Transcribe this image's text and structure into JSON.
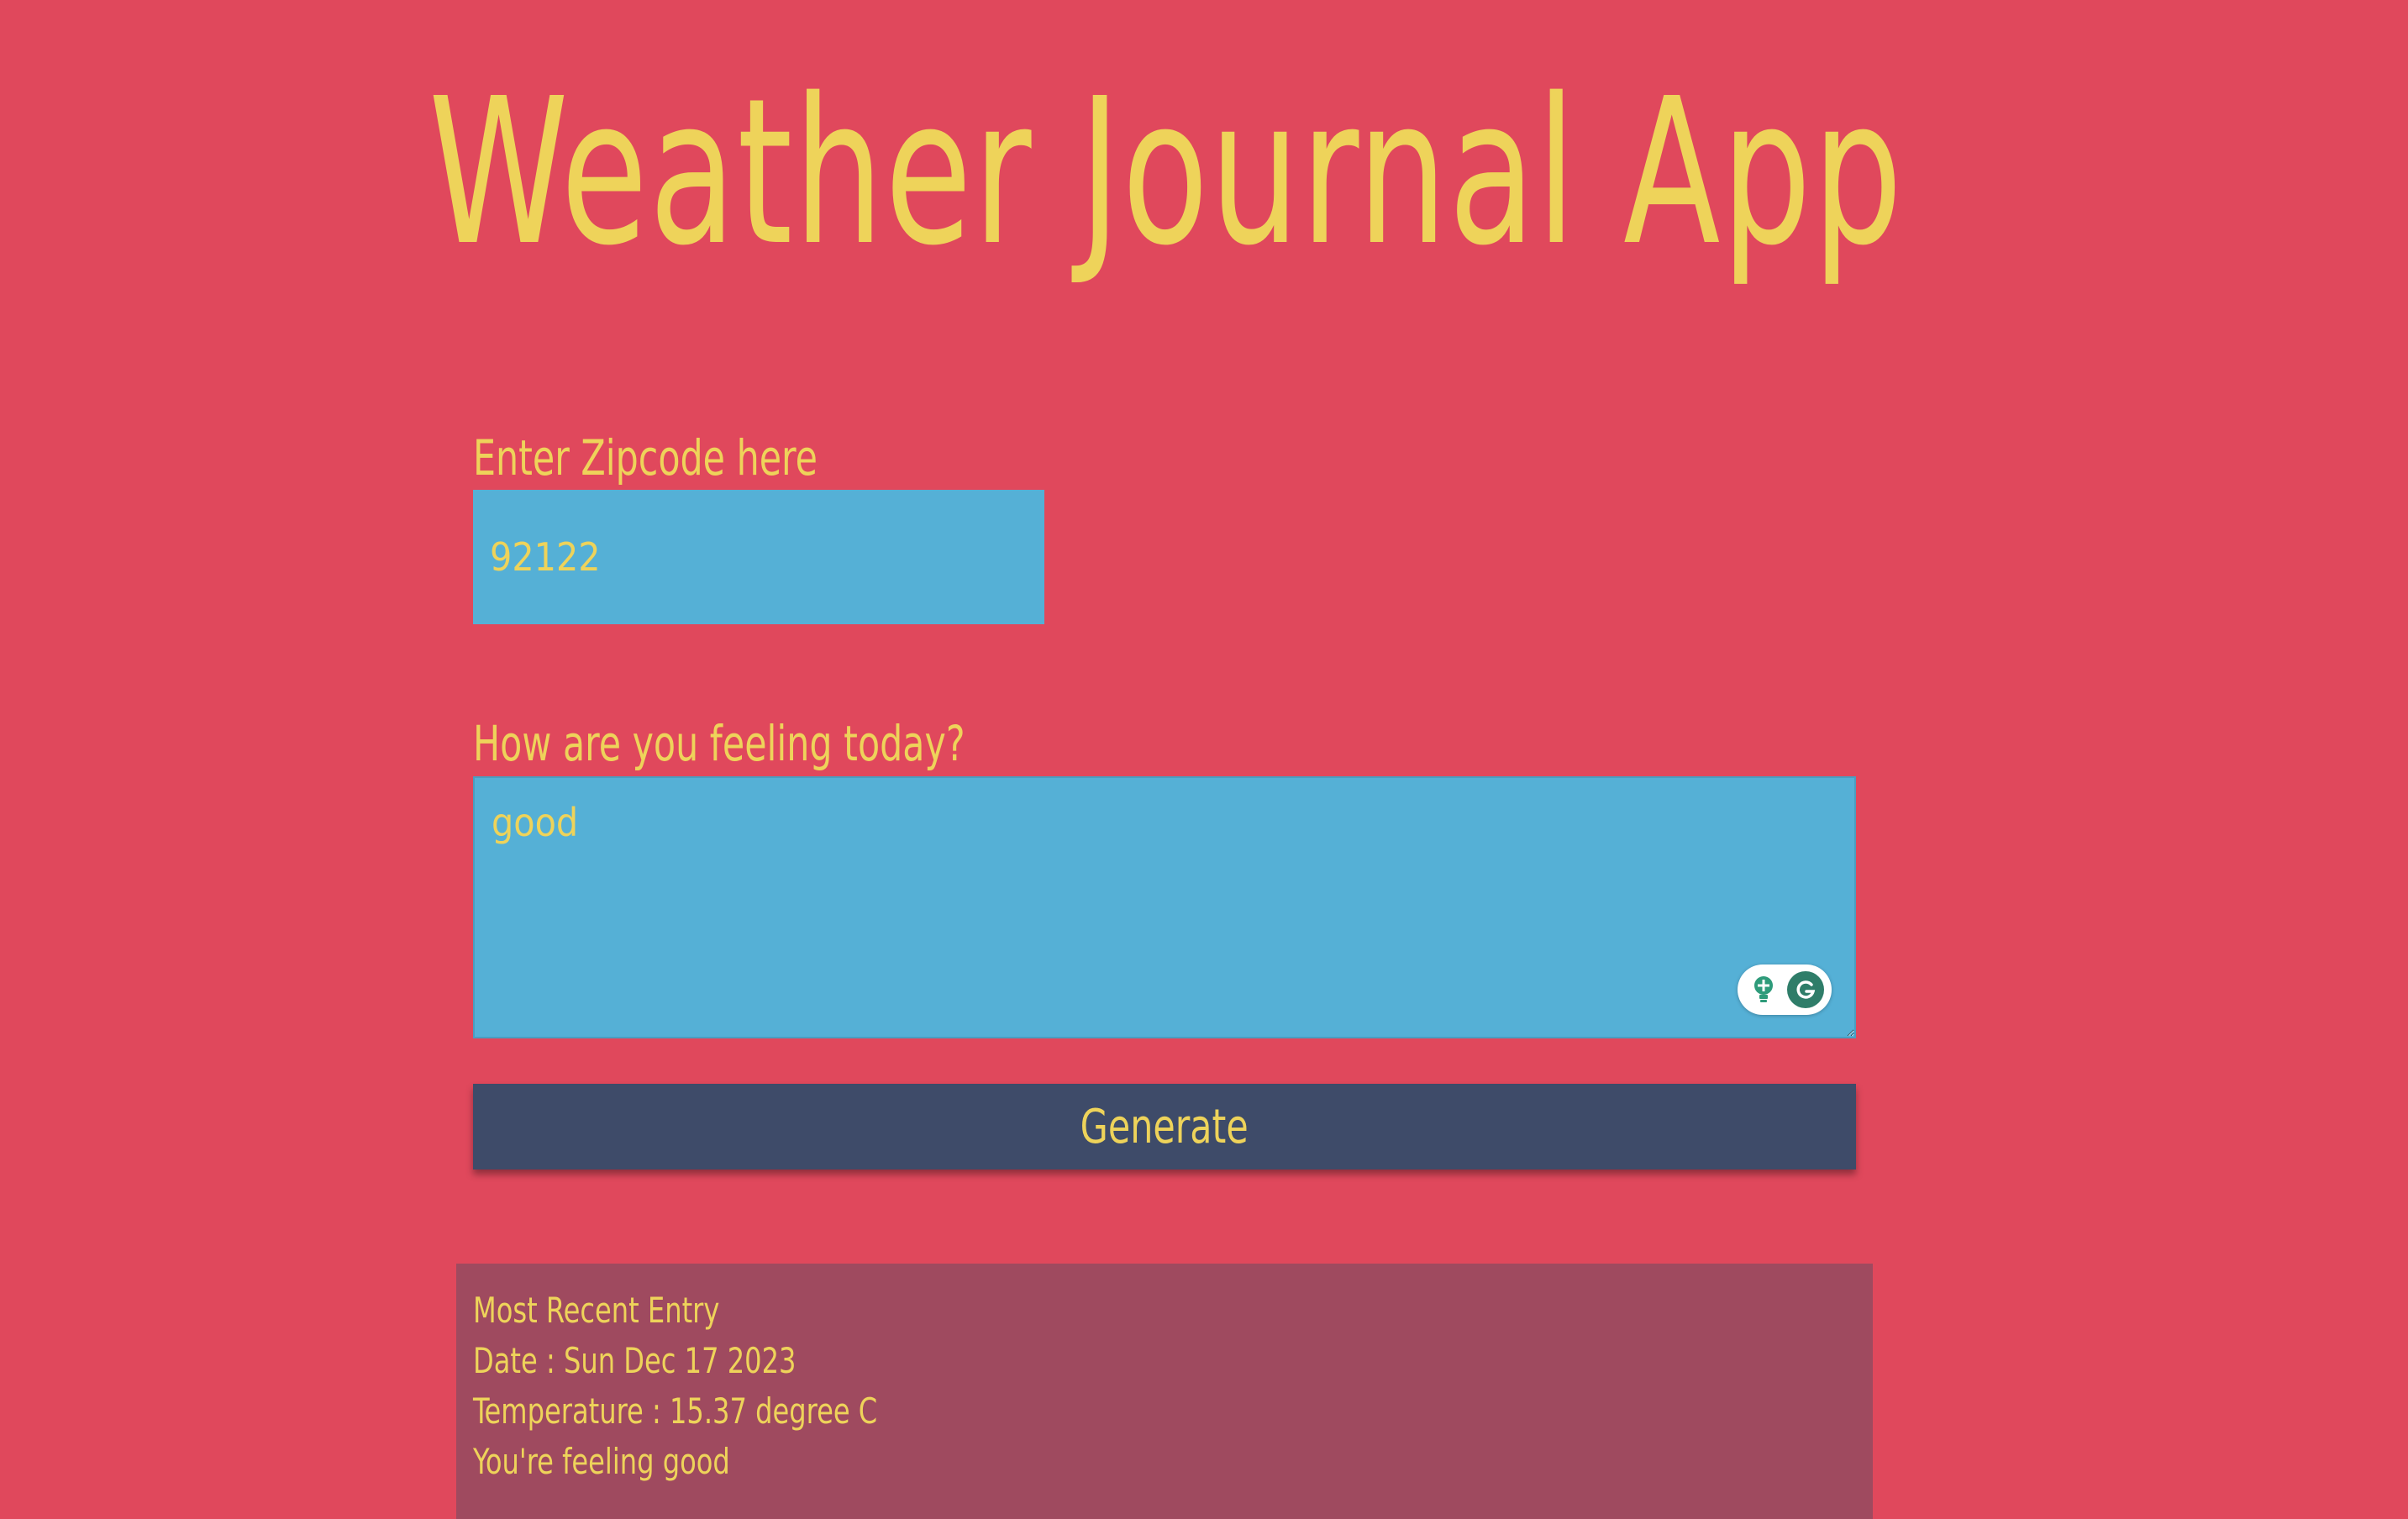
{
  "header": {
    "title": "Weather Journal App"
  },
  "form": {
    "zip_label": "Enter Zipcode here",
    "zip_value": "92122",
    "feelings_label": "How are you feeling today?",
    "feelings_value": "good",
    "generate_label": "Generate"
  },
  "entry": {
    "heading": "Most Recent Entry",
    "date": "Date : Sun Dec 17 2023",
    "temperature": "Temperature : 15.37 degree C",
    "content": "You're feeling good"
  },
  "grammarly": {
    "icons": [
      "lightbulb-icon",
      "grammarly-g-icon"
    ],
    "accent": "#2f7d69"
  },
  "colors": {
    "background": "#e0485c",
    "text": "#eed35a",
    "input_bg": "#55b0d6",
    "button_bg": "#3e4b69",
    "entry_bg": "#9f4a5f"
  }
}
